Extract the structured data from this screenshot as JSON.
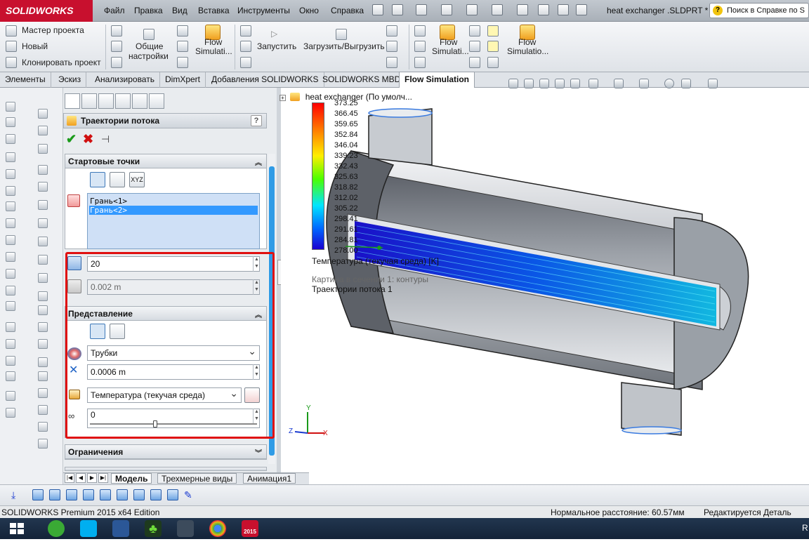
{
  "app": {
    "logo_text": "SOLIDWORKS",
    "document_title": "heat exchanger .SLDPRT *",
    "help_search_placeholder": "Поиск в Справке по S"
  },
  "menu": [
    "Файл",
    "Правка",
    "Вид",
    "Вставка",
    "Инструменты",
    "Окно",
    "Справка"
  ],
  "command_manager": {
    "wizard": "Мастер проекта",
    "new": "Новый",
    "clone": "Клонировать проект",
    "general_settings_1": "Общие",
    "general_settings_2": "настройки",
    "flow_sim_1_a": "Flow",
    "flow_sim_1_b": "Simulati...",
    "run": "Запустить",
    "load_unload": "Загрузить/Выгрузить",
    "flow_sim_2_a": "Flow",
    "flow_sim_2_b": "Simulati...",
    "flow_sim_3_a": "Flow",
    "flow_sim_3_b": "Simulatio..."
  },
  "tabs": [
    "Элементы",
    "Эскиз",
    "Анализировать",
    "DimXpert",
    "Добавления SOLIDWORKS",
    "SOLIDWORKS MBD",
    "Flow Simulation"
  ],
  "active_tab": "Flow Simulation",
  "property_manager": {
    "title": "Траектории потока",
    "help": "?",
    "start_points": {
      "header": "Стартовые точки",
      "faces": [
        "Грань<1>",
        "Грань<2>"
      ],
      "selected_face": "Грань<2>",
      "xyz_label": "XYZ",
      "number_of_points": "20",
      "offset": "0.002 m"
    },
    "appearance": {
      "header": "Представление",
      "draw_as": "Трубки",
      "width": "0.0006 m",
      "color_by": "Температура (текучая среда)",
      "transparency": "0",
      "transparency_level": 0
    },
    "constraints": {
      "header": "Ограничения"
    }
  },
  "viewport": {
    "tree_label": "heat exchanger  (По умолч...",
    "colorbar_values": [
      "373.25",
      "366.45",
      "359.65",
      "352.84",
      "346.04",
      "339.23",
      "332.43",
      "325.63",
      "318.82",
      "312.02",
      "305.22",
      "298.41",
      "291.61",
      "284.81",
      "278.00"
    ],
    "legend_title": "Температура (текучая среда) [K]",
    "cut_plot": "Картина в сечении 1: контуры",
    "trajectories": "Траектории потока 1",
    "axis_x": "X",
    "axis_y": "Y",
    "axis_z": "Z"
  },
  "bottom_tabs": [
    "Модель",
    "Трехмерные виды",
    "Анимация1"
  ],
  "active_bottom_tab": "Модель",
  "status": {
    "edition": "SOLIDWORKS Premium 2015 x64 Edition",
    "distance": "Нормальное расстояние: 60.57мм",
    "mode": "Редактируется Деталь"
  },
  "taskbar": {
    "right_text": "R",
    "sw_badge": "2015"
  },
  "colors": {
    "highlight_red": "#e01010",
    "accent_blue": "#3399ff",
    "sw_red": "#c8102e"
  }
}
